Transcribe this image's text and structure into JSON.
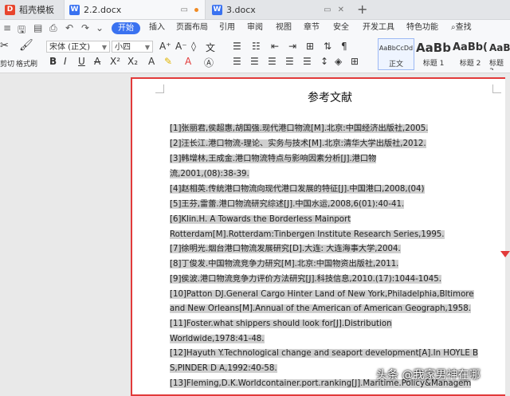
{
  "tabs": [
    {
      "label": "稻壳模板",
      "icon": "docer-icon",
      "color": "#e8452d"
    },
    {
      "label": "2.2.docx",
      "icon": "word-doc-icon",
      "color": "#3a72f0"
    },
    {
      "label": "3.docx",
      "icon": "word-doc-icon",
      "color": "#3a72f0"
    }
  ],
  "menu": {
    "start": "开始",
    "items": [
      "插入",
      "页面布局",
      "引用",
      "审阅",
      "视图",
      "章节",
      "安全",
      "开发工具",
      "特色功能"
    ],
    "search": "查找"
  },
  "toolbar": {
    "cut": "剪切",
    "format_painter": "格式刷",
    "font": "宋体 (正文)",
    "size": "小四",
    "styles": [
      {
        "sample": "AaBbCcDd",
        "label": "正文"
      },
      {
        "sample": "AaBb",
        "label": "标题 1"
      },
      {
        "sample": "AaBb(",
        "label": "标题 2"
      },
      {
        "sample": "AaBb",
        "label": "标题 3"
      }
    ]
  },
  "document": {
    "title": "参考文献",
    "lines": [
      "[1]张丽君,侯超惠,胡国强.现代港口物流[M].北京:中国经济出版社,2005.",
      "[2]汪长江.港口物流-理论、实务与技术[M].北京:清华大学出版社,2012.",
      "[3]韩增林,王成金.港口物流特点与影响因素分析[J].港口物",
      "流,2001,(08):38-39.",
      "[4]赵相英.传统港口物流向现代港口发展的特征[J].中国港口,2008,(04)",
      "[5]王芬,雷蕾.港口物流研究综述[J].中国水运,2008,6(01):40-41.",
      "[6]Klin.H. A Towards the Borderless Mainport",
      "Rotterdam[M].Rotterdam:Tinbergen Institute Research Series,1995.",
      "[7]徐明光.烟台港口物流发展研究[D].大连: 大连海事大学,2004.",
      "[8]丁俊发.中国物流竞争力研究[M].北京:中国物资出版社,2011.",
      "[9]侯波.港口物流竞争力评价方法研究[J].科技信息,2010.(17):1044-1045.",
      "[10]Patton DJ.General Cargo Hinter Land of New York,Philadelphia,Bltimore",
      "and New Orleans[M].Annual of the American of American Geograph,1958.",
      "[11]Foster.what shippers should look for[J].Distribution",
      "Worldwide,1978:41-48.",
      "[12]Hayuth Y.Technological change and seaport development[A].In HOYLE B",
      "S,PINDER D A,1992:40-58.",
      "[13]Fleming,D.K.Worldcontainer.port.ranking[J].Maritime.Policy&Managem"
    ]
  },
  "watermark": "头条 @我家男神在哪"
}
